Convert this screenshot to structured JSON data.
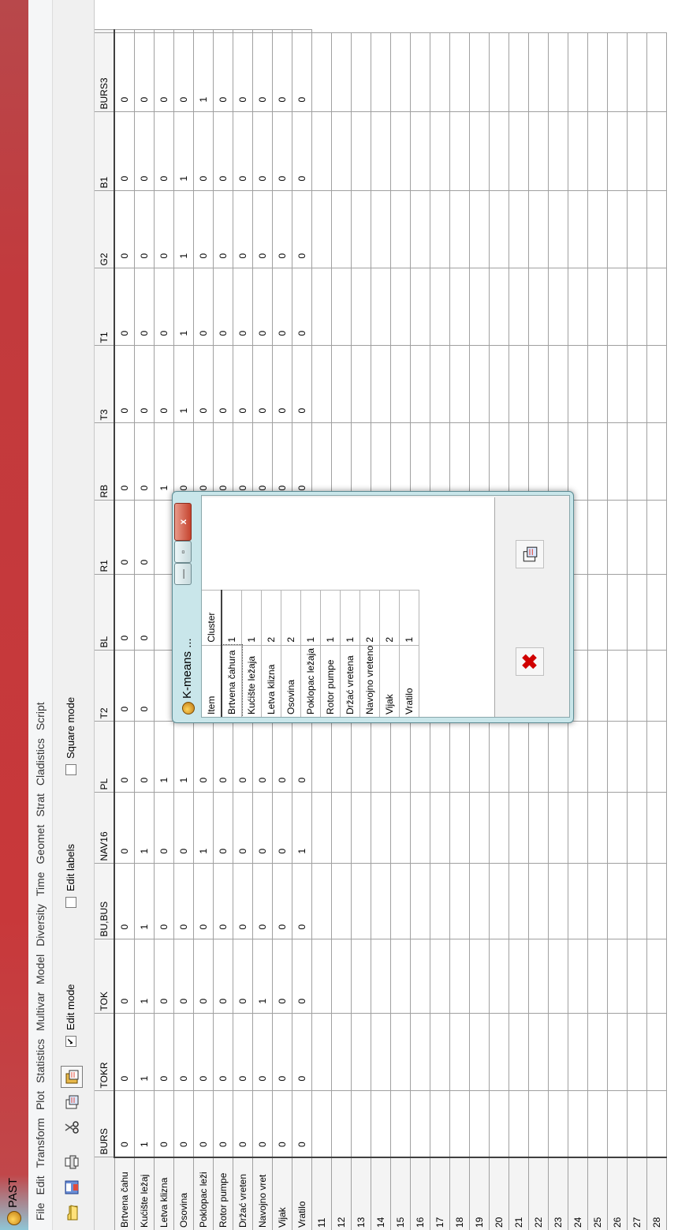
{
  "window": {
    "title": "PAST"
  },
  "menu": [
    "File",
    "Edit",
    "Transform",
    "Plot",
    "Statistics",
    "Multivar",
    "Model",
    "Diversity",
    "Time",
    "Geomet",
    "Strat",
    "Cladistics",
    "Script"
  ],
  "toolbar": {
    "icons": [
      "open-folder-icon",
      "save-icon",
      "print-icon",
      "cut-icon",
      "copy-icon",
      "paste-icon"
    ],
    "edit_mode_label": "Edit mode",
    "edit_mode_checked": true,
    "edit_labels_label": "Edit labels",
    "edit_labels_checked": false,
    "square_mode_label": "Square mode",
    "square_mode_checked": false,
    "checkmark": "✔"
  },
  "sheet": {
    "columns": [
      "BURS",
      "TOKR",
      "TOK",
      "BU,BUS",
      "NAV16",
      "PL",
      "T2",
      "BL",
      "R1",
      "RB",
      "T3",
      "T1",
      "G2",
      "B1",
      "BURS3"
    ],
    "rows": [
      {
        "label": "Brtvena čahu",
        "values": [
          "0",
          "0",
          "0",
          "0",
          "0",
          "0",
          "0",
          "0",
          "0",
          "0",
          "0",
          "0",
          "0",
          "0",
          "0"
        ]
      },
      {
        "label": "Kućište ležaj",
        "values": [
          "1",
          "1",
          "1",
          "1",
          "1",
          "0",
          "0",
          "0",
          "0",
          "0",
          "0",
          "0",
          "0",
          "0",
          "0"
        ]
      },
      {
        "label": "Letva klizna",
        "values": [
          "0",
          "0",
          "0",
          "0",
          "0",
          "1",
          "",
          "",
          "",
          "1",
          "0",
          "0",
          "0",
          "0",
          "0"
        ]
      },
      {
        "label": "Osovina",
        "values": [
          "0",
          "0",
          "0",
          "0",
          "0",
          "1",
          "",
          "",
          "",
          "0",
          "1",
          "1",
          "1",
          "1",
          "0"
        ]
      },
      {
        "label": "Poklopac leži",
        "values": [
          "0",
          "0",
          "0",
          "0",
          "1",
          "0",
          "",
          "",
          "",
          "0",
          "0",
          "0",
          "0",
          "0",
          "1"
        ]
      },
      {
        "label": "Rotor pumpe",
        "values": [
          "0",
          "0",
          "0",
          "0",
          "0",
          "0",
          "",
          "",
          "",
          "0",
          "0",
          "0",
          "0",
          "0",
          "0"
        ]
      },
      {
        "label": "Držać vreten",
        "values": [
          "0",
          "0",
          "0",
          "0",
          "0",
          "0",
          "",
          "",
          "",
          "0",
          "0",
          "0",
          "0",
          "0",
          "0"
        ]
      },
      {
        "label": "Navojno vret",
        "values": [
          "0",
          "0",
          "1",
          "0",
          "0",
          "0",
          "",
          "",
          "",
          "0",
          "0",
          "0",
          "0",
          "0",
          "0"
        ]
      },
      {
        "label": "Vijak",
        "values": [
          "0",
          "0",
          "0",
          "0",
          "0",
          "0",
          "",
          "",
          "",
          "0",
          "0",
          "0",
          "0",
          "0",
          "0"
        ]
      },
      {
        "label": "Vratilo",
        "values": [
          "0",
          "0",
          "0",
          "0",
          "1",
          "0",
          "",
          "",
          "",
          "0",
          "0",
          "0",
          "0",
          "0",
          "0"
        ]
      }
    ],
    "empty_rows": [
      "11",
      "12",
      "13",
      "14",
      "15",
      "16",
      "17",
      "18",
      "19",
      "20",
      "21",
      "22",
      "23",
      "24",
      "25",
      "26",
      "27",
      "28"
    ]
  },
  "dialog": {
    "title": "K-means ...",
    "headers": [
      "Item",
      "Cluster"
    ],
    "rows": [
      {
        "item": "Brtvena čahura",
        "cluster": "1"
      },
      {
        "item": "Kućište ležaja",
        "cluster": "1"
      },
      {
        "item": "Letva klizna",
        "cluster": "2"
      },
      {
        "item": "Osovina",
        "cluster": "2"
      },
      {
        "item": "Poklopac ležaja",
        "cluster": "1"
      },
      {
        "item": "Rotor pumpe",
        "cluster": "1"
      },
      {
        "item": "Držać vretena",
        "cluster": "1"
      },
      {
        "item": "Navojno vreteno",
        "cluster": "2"
      },
      {
        "item": "Vijak",
        "cluster": "2"
      },
      {
        "item": "Vratilo",
        "cluster": "1"
      }
    ],
    "minimize_glyph": "—",
    "maximize_glyph": "▫",
    "close_glyph": "x",
    "cancel_glyph": "✖"
  }
}
